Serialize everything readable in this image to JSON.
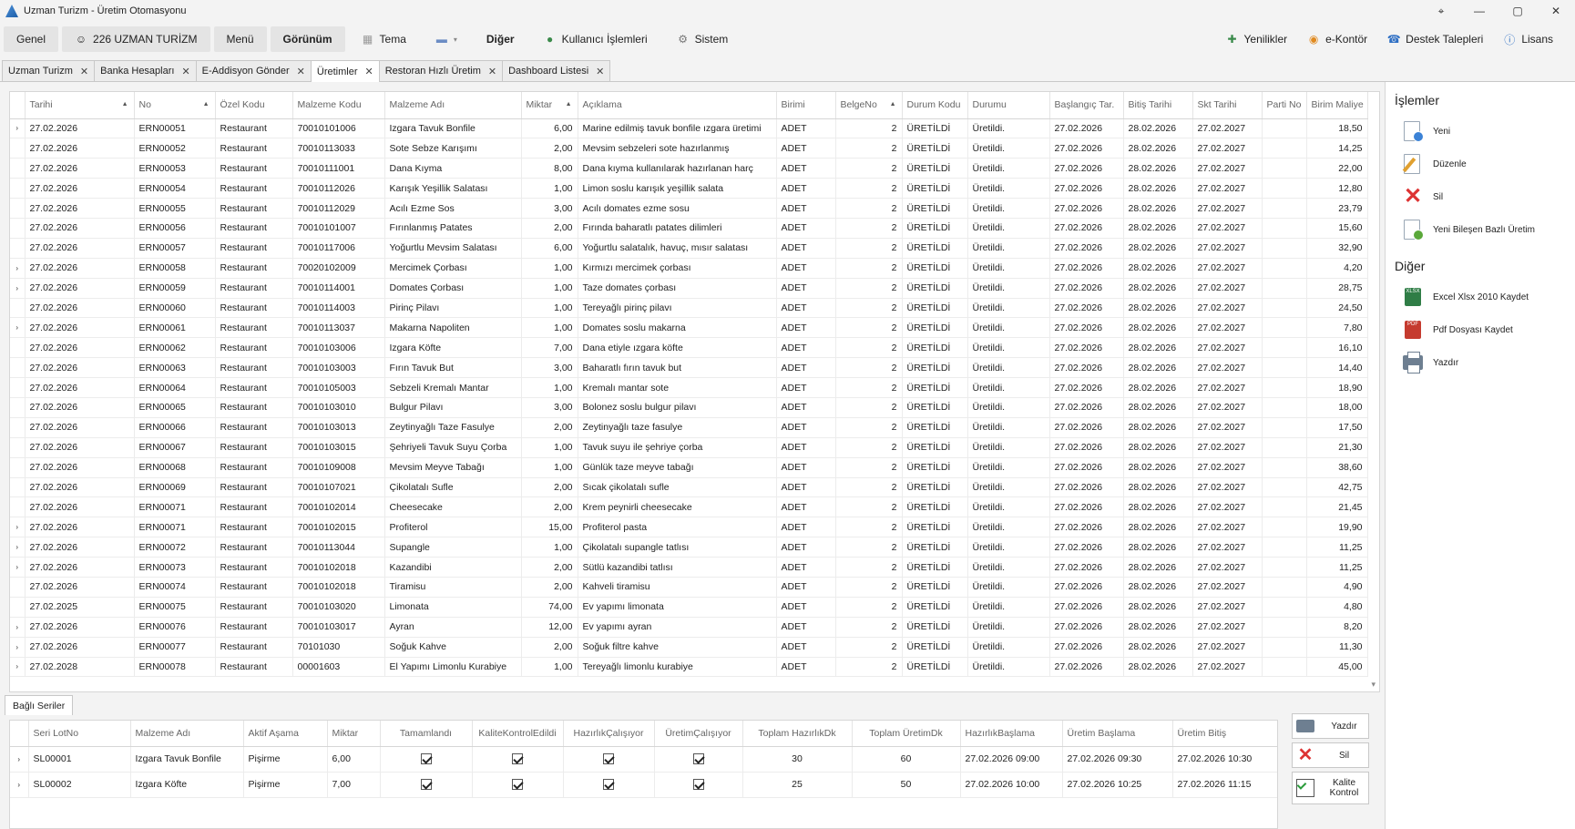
{
  "window": {
    "title": "Uzman Turizm - Üretim Otomasyonu",
    "controls": [
      "⌖",
      "—",
      "▢",
      "✕"
    ]
  },
  "menu": {
    "left": [
      {
        "label": "Genel",
        "shaded": true,
        "icon": ""
      },
      {
        "label": "226 UZMAN TURİZM",
        "shaded": true,
        "icon": "users-icon"
      },
      {
        "label": "Menü",
        "shaded": true,
        "icon": ""
      },
      {
        "label": "Görünüm",
        "shaded": true,
        "bold": true,
        "icon": ""
      },
      {
        "label": "Tema",
        "shaded": false,
        "icon": "grid-icon"
      },
      {
        "label": "",
        "shaded": false,
        "icon": "monitor-icon"
      },
      {
        "label": "Diğer",
        "shaded": false,
        "bold": true,
        "icon": ""
      },
      {
        "label": "Kullanıcı İşlemleri",
        "shaded": false,
        "icon": "user-icon"
      },
      {
        "label": "Sistem",
        "shaded": false,
        "icon": "gear-icon"
      }
    ],
    "right": [
      {
        "label": "Yenilikler",
        "icon": "news-icon"
      },
      {
        "label": "e-Kontör",
        "icon": "coins-icon"
      },
      {
        "label": "Destek Talepleri",
        "icon": "support-icon"
      },
      {
        "label": "Lisans",
        "icon": "info-icon"
      }
    ]
  },
  "doc_tabs": [
    {
      "label": "Uzman Turizm",
      "active": false
    },
    {
      "label": "Banka Hesapları",
      "active": false
    },
    {
      "label": "E-Addisyon Gönder",
      "active": false
    },
    {
      "label": "Üretimler",
      "active": true
    },
    {
      "label": "Restoran Hızlı Üretim",
      "active": false
    },
    {
      "label": "Dashboard Listesi",
      "active": false
    }
  ],
  "grid": {
    "columns": [
      "Tarihi",
      "No",
      "Özel Kodu",
      "Malzeme Kodu",
      "Malzeme Adı",
      "Miktar",
      "Açıklama",
      "Birimi",
      "BelgeNo",
      "Durum Kodu",
      "Durumu",
      "Başlangıç Tar.",
      "Bitiş Tarihi",
      "Skt Tarihi",
      "Parti No",
      "Birim Maliye"
    ],
    "sorted_columns": [
      "Tarihi",
      "No",
      "Miktar",
      "BelgeNo"
    ],
    "rows": [
      {
        "ind": "›",
        "tarih": "27.02.2026",
        "no": "ERN00051",
        "ozel": "Restaurant",
        "kod": "70010101006",
        "ad": "Izgara Tavuk Bonfile",
        "miktar": "6,00",
        "aciklama": "Marine edilmiş tavuk bonfile ızgara üretimi",
        "birim": "ADET",
        "belge": "2",
        "durumKodu": "ÜRETİLDİ",
        "durum": "Üretildi.",
        "bas": "27.02.2026",
        "bit": "28.02.2026",
        "skt": "27.02.2027",
        "parti": "",
        "maliyet": "18,50"
      },
      {
        "ind": "",
        "tarih": "27.02.2026",
        "no": "ERN00052",
        "ozel": "Restaurant",
        "kod": "70010113033",
        "ad": "Sote Sebze Karışımı",
        "miktar": "2,00",
        "aciklama": "Mevsim sebzeleri sote hazırlanmış",
        "birim": "ADET",
        "belge": "2",
        "durumKodu": "ÜRETİLDİ",
        "durum": "Üretildi.",
        "bas": "27.02.2026",
        "bit": "28.02.2026",
        "skt": "27.02.2027",
        "parti": "",
        "maliyet": "14,25"
      },
      {
        "ind": "",
        "tarih": "27.02.2026",
        "no": "ERN00053",
        "ozel": "Restaurant",
        "kod": "70010111001",
        "ad": "Dana Kıyma",
        "miktar": "8,00",
        "aciklama": "Dana kıyma kullanılarak hazırlanan harç",
        "birim": "ADET",
        "belge": "2",
        "durumKodu": "ÜRETİLDİ",
        "durum": "Üretildi.",
        "bas": "27.02.2026",
        "bit": "28.02.2026",
        "skt": "27.02.2027",
        "parti": "",
        "maliyet": "22,00"
      },
      {
        "ind": "",
        "tarih": "27.02.2026",
        "no": "ERN00054",
        "ozel": "Restaurant",
        "kod": "70010112026",
        "ad": "Karışık Yeşillik Salatası",
        "miktar": "1,00",
        "aciklama": "Limon soslu karışık yeşillik salata",
        "birim": "ADET",
        "belge": "2",
        "durumKodu": "ÜRETİLDİ",
        "durum": "Üretildi.",
        "bas": "27.02.2026",
        "bit": "28.02.2026",
        "skt": "27.02.2027",
        "parti": "",
        "maliyet": "12,80"
      },
      {
        "ind": "",
        "tarih": "27.02.2026",
        "no": "ERN00055",
        "ozel": "Restaurant",
        "kod": "70010112029",
        "ad": "Acılı Ezme Sos",
        "miktar": "3,00",
        "aciklama": "Acılı domates ezme sosu",
        "birim": "ADET",
        "belge": "2",
        "durumKodu": "ÜRETİLDİ",
        "durum": "Üretildi.",
        "bas": "27.02.2026",
        "bit": "28.02.2026",
        "skt": "27.02.2027",
        "parti": "",
        "maliyet": "23,79"
      },
      {
        "ind": "",
        "tarih": "27.02.2026",
        "no": "ERN00056",
        "ozel": "Restaurant",
        "kod": "70010101007",
        "ad": "Fırınlanmış Patates",
        "miktar": "2,00",
        "aciklama": "Fırında baharatlı patates dilimleri",
        "birim": "ADET",
        "belge": "2",
        "durumKodu": "ÜRETİLDİ",
        "durum": "Üretildi.",
        "bas": "27.02.2026",
        "bit": "28.02.2026",
        "skt": "27.02.2027",
        "parti": "",
        "maliyet": "15,60"
      },
      {
        "ind": "",
        "tarih": "27.02.2026",
        "no": "ERN00057",
        "ozel": "Restaurant",
        "kod": "70010117006",
        "ad": "Yoğurtlu Mevsim Salatası",
        "miktar": "6,00",
        "aciklama": "Yoğurtlu salatalık, havuç, mısır salatası",
        "birim": "ADET",
        "belge": "2",
        "durumKodu": "ÜRETİLDİ",
        "durum": "Üretildi.",
        "bas": "27.02.2026",
        "bit": "28.02.2026",
        "skt": "27.02.2027",
        "parti": "",
        "maliyet": "32,90"
      },
      {
        "ind": "›",
        "tarih": "27.02.2026",
        "no": "ERN00058",
        "ozel": "Restaurant",
        "kod": "70020102009",
        "ad": "Mercimek Çorbası",
        "miktar": "1,00",
        "aciklama": "Kırmızı mercimek çorbası",
        "birim": "ADET",
        "belge": "2",
        "durumKodu": "ÜRETİLDİ",
        "durum": "Üretildi.",
        "bas": "27.02.2026",
        "bit": "28.02.2026",
        "skt": "27.02.2027",
        "parti": "",
        "maliyet": "4,20"
      },
      {
        "ind": "›",
        "tarih": "27.02.2026",
        "no": "ERN00059",
        "ozel": "Restaurant",
        "kod": "70010114001",
        "ad": "Domates Çorbası",
        "miktar": "1,00",
        "aciklama": "Taze domates çorbası",
        "birim": "ADET",
        "belge": "2",
        "durumKodu": "ÜRETİLDİ",
        "durum": "Üretildi.",
        "bas": "27.02.2026",
        "bit": "28.02.2026",
        "skt": "27.02.2027",
        "parti": "",
        "maliyet": "28,75"
      },
      {
        "ind": "",
        "tarih": "27.02.2026",
        "no": "ERN00060",
        "ozel": "Restaurant",
        "kod": "70010114003",
        "ad": "Pirinç Pilavı",
        "miktar": "1,00",
        "aciklama": "Tereyağlı pirinç pilavı",
        "birim": "ADET",
        "belge": "2",
        "durumKodu": "ÜRETİLDİ",
        "durum": "Üretildi.",
        "bas": "27.02.2026",
        "bit": "28.02.2026",
        "skt": "27.02.2027",
        "parti": "",
        "maliyet": "24,50"
      },
      {
        "ind": "›",
        "tarih": "27.02.2026",
        "no": "ERN00061",
        "ozel": "Restaurant",
        "kod": "70010113037",
        "ad": "Makarna Napoliten",
        "miktar": "1,00",
        "aciklama": "Domates soslu makarna",
        "birim": "ADET",
        "belge": "2",
        "durumKodu": "ÜRETİLDİ",
        "durum": "Üretildi.",
        "bas": "27.02.2026",
        "bit": "28.02.2026",
        "skt": "27.02.2027",
        "parti": "",
        "maliyet": "7,80"
      },
      {
        "ind": "",
        "tarih": "27.02.2026",
        "no": "ERN00062",
        "ozel": "Restaurant",
        "kod": "70010103006",
        "ad": "Izgara Köfte",
        "miktar": "7,00",
        "aciklama": "Dana etiyle ızgara köfte",
        "birim": "ADET",
        "belge": "2",
        "durumKodu": "ÜRETİLDİ",
        "durum": "Üretildi.",
        "bas": "27.02.2026",
        "bit": "28.02.2026",
        "skt": "27.02.2027",
        "parti": "",
        "maliyet": "16,10"
      },
      {
        "ind": "",
        "tarih": "27.02.2026",
        "no": "ERN00063",
        "ozel": "Restaurant",
        "kod": "70010103003",
        "ad": "Fırın Tavuk But",
        "miktar": "3,00",
        "aciklama": "Baharatlı fırın tavuk but",
        "birim": "ADET",
        "belge": "2",
        "durumKodu": "ÜRETİLDİ",
        "durum": "Üretildi.",
        "bas": "27.02.2026",
        "bit": "28.02.2026",
        "skt": "27.02.2027",
        "parti": "",
        "maliyet": "14,40"
      },
      {
        "ind": "",
        "tarih": "27.02.2026",
        "no": "ERN00064",
        "ozel": "Restaurant",
        "kod": "70010105003",
        "ad": "Sebzeli Kremalı Mantar",
        "miktar": "1,00",
        "aciklama": "Kremalı mantar sote",
        "birim": "ADET",
        "belge": "2",
        "durumKodu": "ÜRETİLDİ",
        "durum": "Üretildi.",
        "bas": "27.02.2026",
        "bit": "28.02.2026",
        "skt": "27.02.2027",
        "parti": "",
        "maliyet": "18,90"
      },
      {
        "ind": "",
        "tarih": "27.02.2026",
        "no": "ERN00065",
        "ozel": "Restaurant",
        "kod": "70010103010",
        "ad": "Bulgur Pilavı",
        "miktar": "3,00",
        "aciklama": "Bolonez soslu bulgur pilavı",
        "birim": "ADET",
        "belge": "2",
        "durumKodu": "ÜRETİLDİ",
        "durum": "Üretildi.",
        "bas": "27.02.2026",
        "bit": "28.02.2026",
        "skt": "27.02.2027",
        "parti": "",
        "maliyet": "18,00"
      },
      {
        "ind": "",
        "tarih": "27.02.2026",
        "no": "ERN00066",
        "ozel": "Restaurant",
        "kod": "70010103013",
        "ad": "Zeytinyağlı Taze Fasulye",
        "miktar": "2,00",
        "aciklama": "Zeytinyağlı taze fasulye",
        "birim": "ADET",
        "belge": "2",
        "durumKodu": "ÜRETİLDİ",
        "durum": "Üretildi.",
        "bas": "27.02.2026",
        "bit": "28.02.2026",
        "skt": "27.02.2027",
        "parti": "",
        "maliyet": "17,50"
      },
      {
        "ind": "",
        "tarih": "27.02.2026",
        "no": "ERN00067",
        "ozel": "Restaurant",
        "kod": "70010103015",
        "ad": "Şehriyeli Tavuk Suyu Çorba",
        "miktar": "1,00",
        "aciklama": "Tavuk suyu ile şehriye çorba",
        "birim": "ADET",
        "belge": "2",
        "durumKodu": "ÜRETİLDİ",
        "durum": "Üretildi.",
        "bas": "27.02.2026",
        "bit": "28.02.2026",
        "skt": "27.02.2027",
        "parti": "",
        "maliyet": "21,30"
      },
      {
        "ind": "",
        "tarih": "27.02.2026",
        "no": "ERN00068",
        "ozel": "Restaurant",
        "kod": "70010109008",
        "ad": "Mevsim Meyve Tabağı",
        "miktar": "1,00",
        "aciklama": "Günlük taze meyve tabağı",
        "birim": "ADET",
        "belge": "2",
        "durumKodu": "ÜRETİLDİ",
        "durum": "Üretildi.",
        "bas": "27.02.2026",
        "bit": "28.02.2026",
        "skt": "27.02.2027",
        "parti": "",
        "maliyet": "38,60"
      },
      {
        "ind": "",
        "tarih": "27.02.2026",
        "no": "ERN00069",
        "ozel": "Restaurant",
        "kod": "70010107021",
        "ad": "Çikolatalı Sufle",
        "miktar": "2,00",
        "aciklama": "Sıcak çikolatalı sufle",
        "birim": "ADET",
        "belge": "2",
        "durumKodu": "ÜRETİLDİ",
        "durum": "Üretildi.",
        "bas": "27.02.2026",
        "bit": "28.02.2026",
        "skt": "27.02.2027",
        "parti": "",
        "maliyet": "42,75"
      },
      {
        "ind": "",
        "tarih": "27.02.2026",
        "no": "ERN00071",
        "ozel": "Restaurant",
        "kod": "70010102014",
        "ad": "Cheesecake",
        "miktar": "2,00",
        "aciklama": "Krem peynirli cheesecake",
        "birim": "ADET",
        "belge": "2",
        "durumKodu": "ÜRETİLDİ",
        "durum": "Üretildi.",
        "bas": "27.02.2026",
        "bit": "28.02.2026",
        "skt": "27.02.2027",
        "parti": "",
        "maliyet": "21,45"
      },
      {
        "ind": "›",
        "tarih": "27.02.2026",
        "no": "ERN00071",
        "ozel": "Restaurant",
        "kod": "70010102015",
        "ad": "Profiterol",
        "miktar": "15,00",
        "aciklama": "Profiterol pasta",
        "birim": "ADET",
        "belge": "2",
        "durumKodu": "ÜRETİLDİ",
        "durum": "Üretildi.",
        "bas": "27.02.2026",
        "bit": "28.02.2026",
        "skt": "27.02.2027",
        "parti": "",
        "maliyet": "19,90"
      },
      {
        "ind": "›",
        "tarih": "27.02.2026",
        "no": "ERN00072",
        "ozel": "Restaurant",
        "kod": "70010113044",
        "ad": "Supangle",
        "miktar": "1,00",
        "aciklama": "Çikolatalı supangle tatlısı",
        "birim": "ADET",
        "belge": "2",
        "durumKodu": "ÜRETİLDİ",
        "durum": "Üretildi.",
        "bas": "27.02.2026",
        "bit": "28.02.2026",
        "skt": "27.02.2027",
        "parti": "",
        "maliyet": "11,25"
      },
      {
        "ind": "›",
        "tarih": "27.02.2026",
        "no": "ERN00073",
        "ozel": "Restaurant",
        "kod": "70010102018",
        "ad": "Kazandibi",
        "miktar": "2,00",
        "aciklama": "Sütlü kazandibi tatlısı",
        "birim": "ADET",
        "belge": "2",
        "durumKodu": "ÜRETİLDİ",
        "durum": "Üretildi.",
        "bas": "27.02.2026",
        "bit": "28.02.2026",
        "skt": "27.02.2027",
        "parti": "",
        "maliyet": "11,25"
      },
      {
        "ind": "",
        "tarih": "27.02.2026",
        "no": "ERN00074",
        "ozel": "Restaurant",
        "kod": "70010102018",
        "ad": "Tiramisu",
        "miktar": "2,00",
        "aciklama": "Kahveli tiramisu",
        "birim": "ADET",
        "belge": "2",
        "durumKodu": "ÜRETİLDİ",
        "durum": "Üretildi.",
        "bas": "27.02.2026",
        "bit": "28.02.2026",
        "skt": "27.02.2027",
        "parti": "",
        "maliyet": "4,90"
      },
      {
        "ind": "",
        "tarih": "27.02.2025",
        "no": "ERN00075",
        "ozel": "Restaurant",
        "kod": "70010103020",
        "ad": "Limonata",
        "miktar": "74,00",
        "aciklama": "Ev yapımı limonata",
        "birim": "ADET",
        "belge": "2",
        "durumKodu": "ÜRETİLDİ",
        "durum": "Üretildi.",
        "bas": "27.02.2026",
        "bit": "28.02.2026",
        "skt": "27.02.2027",
        "parti": "",
        "maliyet": "4,80"
      },
      {
        "ind": "›",
        "tarih": "27.02.2026",
        "no": "ERN00076",
        "ozel": "Restaurant",
        "kod": "70010103017",
        "ad": "Ayran",
        "miktar": "12,00",
        "aciklama": "Ev yapımı ayran",
        "birim": "ADET",
        "belge": "2",
        "durumKodu": "ÜRETİLDİ",
        "durum": "Üretildi.",
        "bas": "27.02.2026",
        "bit": "28.02.2026",
        "skt": "27.02.2027",
        "parti": "",
        "maliyet": "8,20"
      },
      {
        "ind": "›",
        "tarih": "27.02.2026",
        "no": "ERN00077",
        "ozel": "Restaurant",
        "kod": "70101030",
        "ad": "Soğuk Kahve",
        "miktar": "2,00",
        "aciklama": "Soğuk filtre kahve",
        "birim": "ADET",
        "belge": "2",
        "durumKodu": "ÜRETİLDİ",
        "durum": "Üretildi.",
        "bas": "27.02.2026",
        "bit": "28.02.2026",
        "skt": "27.02.2027",
        "parti": "",
        "maliyet": "11,30"
      },
      {
        "ind": "›",
        "tarih": "27.02.2028",
        "no": "ERN00078",
        "ozel": "Restaurant",
        "kod": "00001603",
        "ad": "El Yapımı Limonlu Kurabiye",
        "miktar": "1,00",
        "aciklama": "Tereyağlı limonlu kurabiye",
        "birim": "ADET",
        "belge": "2",
        "durumKodu": "ÜRETİLDİ",
        "durum": "Üretildi.",
        "bas": "27.02.2026",
        "bit": "28.02.2026",
        "skt": "27.02.2027",
        "parti": "",
        "maliyet": "45,00"
      }
    ]
  },
  "right_panel": {
    "islemler_title": "İşlemler",
    "islemler": [
      {
        "label": "Yeni",
        "icon": "new-document-icon"
      },
      {
        "label": "Düzenle",
        "icon": "edit-document-icon"
      },
      {
        "label": "Sil",
        "icon": "delete-x-icon"
      },
      {
        "label": "Yeni Bileşen Bazlı Üretim",
        "icon": "new-component-document-icon"
      }
    ],
    "diger_title": "Diğer",
    "diger": [
      {
        "label": "Excel Xlsx 2010 Kaydet",
        "icon": "excel-icon",
        "tag": "XLSX"
      },
      {
        "label": "Pdf Dosyası Kaydet",
        "icon": "pdf-icon",
        "tag": "PDF"
      },
      {
        "label": "Yazdır",
        "icon": "printer-icon"
      }
    ]
  },
  "bottom": {
    "tab_label": "Bağlı Seriler",
    "columns": [
      "Seri LotNo",
      "Malzeme Adı",
      "Aktif Aşama",
      "Miktar",
      "Tamamlandı",
      "KaliteKontrolEdildi",
      "HazırlıkÇalışıyor",
      "ÜretimÇalışıyor",
      "Toplam HazırlıkDk",
      "Toplam ÜretimDk",
      "HazırlıkBaşlama",
      "Üretim Başlama",
      "Üretim Bitiş"
    ],
    "rows": [
      {
        "ind": "›",
        "lot": "SL00001",
        "ad": "Izgara Tavuk Bonfile",
        "asama": "Pişirme",
        "miktar": "6,00",
        "tamam": true,
        "kalite": true,
        "hazirlik": true,
        "uretim": true,
        "thazirlik": "30",
        "turetim": "60",
        "hbas": "27.02.2026 09:00",
        "ubas": "27.02.2026 09:30",
        "ubit": "27.02.2026 10:30"
      },
      {
        "ind": "›",
        "lot": "SL00002",
        "ad": "Izgara Köfte",
        "asama": "Pişirme",
        "miktar": "7,00",
        "tamam": true,
        "kalite": true,
        "hazirlik": true,
        "uretim": true,
        "thazirlik": "25",
        "turetim": "50",
        "hbas": "27.02.2026 10:00",
        "ubas": "27.02.2026 10:25",
        "ubit": "27.02.2026 11:15"
      }
    ],
    "buttons": [
      {
        "label": "Yazdır",
        "icon": "printer-icon"
      },
      {
        "label": "Sil",
        "icon": "delete-x-icon"
      },
      {
        "label": "Kalite Kontrol",
        "icon": "quality-check-icon"
      }
    ]
  }
}
